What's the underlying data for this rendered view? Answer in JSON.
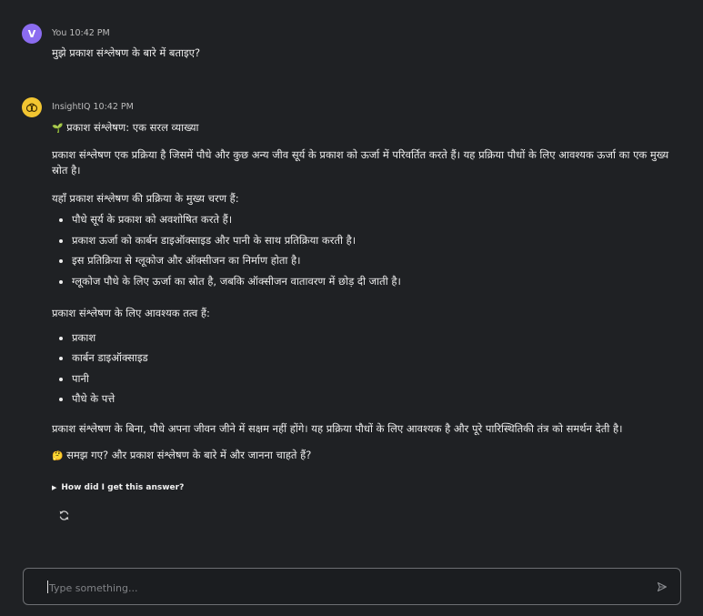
{
  "user_message": {
    "avatar_letter": "V",
    "author": "You",
    "time": "10:42 PM",
    "text": "मुझे प्रकाश संश्लेषण के बारे में बताइए?"
  },
  "bot_message": {
    "avatar_icon": "brain-icon",
    "author": "InsightIQ",
    "time": "10:42 PM",
    "heading_emoji": "🌱",
    "heading": "प्रकाश संश्लेषण: एक सरल व्याख्या",
    "intro": "प्रकाश संश्लेषण एक प्रक्रिया है जिसमें पौधे और कुछ अन्य जीव सूर्य के प्रकाश को ऊर्जा में परिवर्तित करते हैं। यह प्रक्रिया पौधों के लिए आवश्यक ऊर्जा का एक मुख्य स्रोत है।",
    "steps_title": "यहाँ प्रकाश संश्लेषण की प्रक्रिया के मुख्य चरण हैं:",
    "steps": [
      "पौधे सूर्य के प्रकाश को अवशोषित करते हैं।",
      "प्रकाश ऊर्जा को कार्बन डाइऑक्साइड और पानी के साथ प्रतिक्रिया करती है।",
      "इस प्रतिक्रिया से ग्लूकोज और ऑक्सीजन का निर्माण होता है।",
      "ग्लूकोज पौधे के लिए ऊर्जा का स्रोत है, जबकि ऑक्सीजन वातावरण में छोड़ दी जाती है।"
    ],
    "elements_title": "प्रकाश संश्लेषण के लिए आवश्यक तत्व हैं:",
    "elements": [
      "प्रकाश",
      "कार्बन डाइऑक्साइड",
      "पानी",
      "पौधे के पत्ते"
    ],
    "conclusion": "प्रकाश संश्लेषण के बिना, पौधे अपना जीवन जीने में सक्षम नहीं होंगे। यह प्रक्रिया पौधों के लिए आवश्यक है और पूरे पारिस्थितिकी तंत्र को समर्थन देती है।",
    "question_emoji": "🤔",
    "question": "समझ गए? और प्रकाश संश्लेषण के बारे में और जानना चाहते हैं?",
    "details_label": "How did I get this answer?"
  },
  "composer": {
    "placeholder": "Type something..."
  },
  "colors": {
    "background": "#1f2124",
    "user_avatar": "#8b6cf0",
    "bot_avatar": "#f2c531",
    "input_border": "#6d6f73"
  },
  "icons": {
    "regenerate": "refresh-icon",
    "send": "send-icon"
  }
}
